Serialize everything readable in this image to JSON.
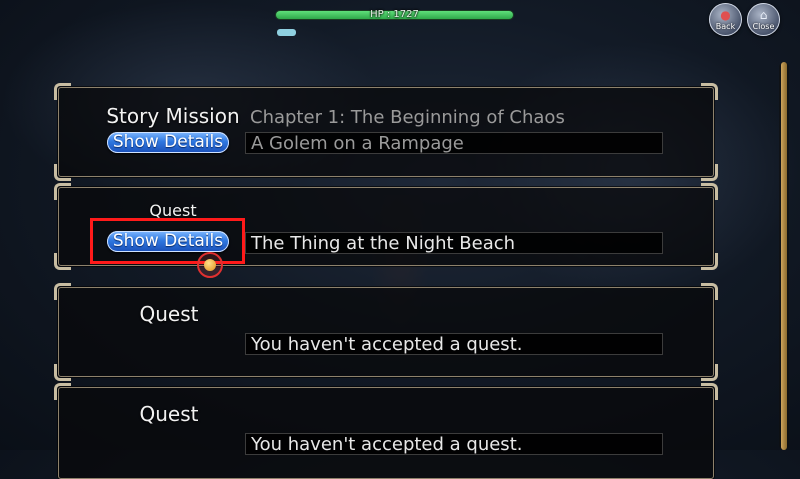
{
  "hud": {
    "hp_text": "HP : 1727",
    "back_label": "Back",
    "close_label": "Close",
    "back_icon": "back-icon",
    "close_icon": "close-icon"
  },
  "panels": [
    {
      "title": "Story Mission",
      "button_label": "Show Details",
      "chapter": "Chapter 1: The Beginning of Chaos",
      "field_text": "A Golem on a Rampage"
    },
    {
      "title": "Quest",
      "button_label": "Show Details",
      "field_text": "The Thing at the Night Beach"
    },
    {
      "title": "Quest",
      "field_text": "You haven't accepted a quest."
    },
    {
      "title": "Quest",
      "field_text": "You haven't accepted a quest."
    }
  ],
  "colors": {
    "hp_bar": "#3fc25a",
    "button_blue": "#2f78e0",
    "highlight_red": "#ff1a1a",
    "frame_gold": "#c8bda2",
    "scroll_thumb": "#cfa55c"
  }
}
